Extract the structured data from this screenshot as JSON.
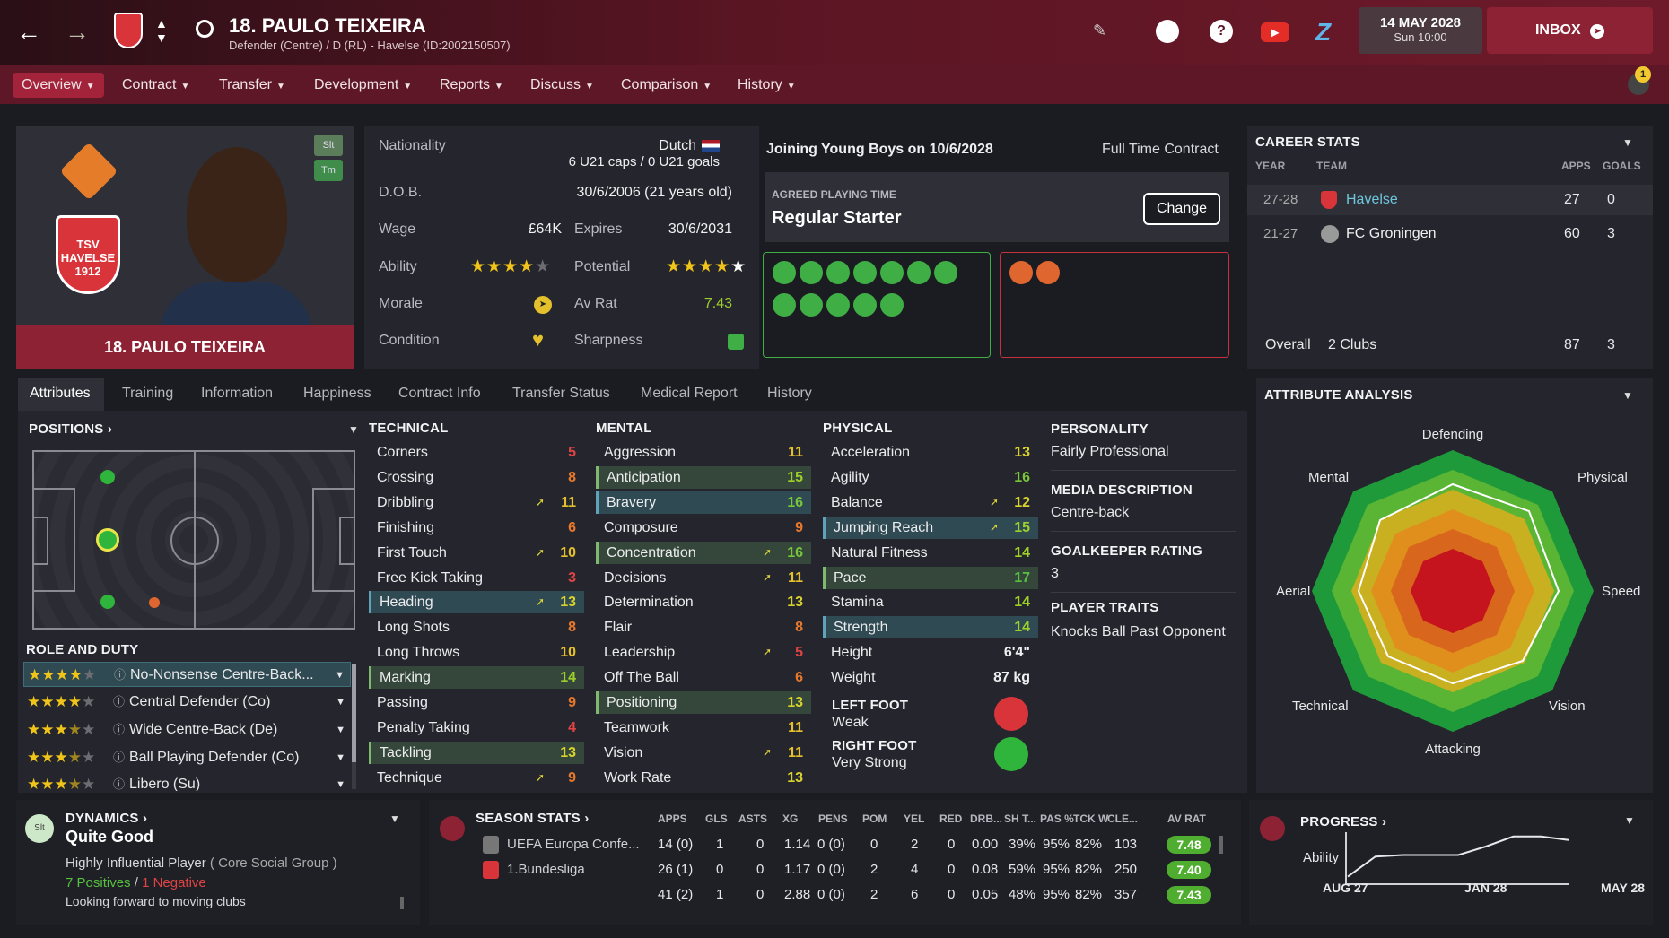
{
  "header": {
    "title": "18. PAULO TEIXEIRA",
    "subtitle": "Defender (Centre) / D (RL) - Havelse (ID:2002150507)",
    "date": "14 MAY 2028",
    "time": "Sun 10:00",
    "inbox": "INBOX",
    "notif_count": "1"
  },
  "nav": [
    "Overview",
    "Contract",
    "Transfer",
    "Development",
    "Reports",
    "Discuss",
    "Comparison",
    "History"
  ],
  "profile": {
    "name": "18. PAULO TEIXEIRA",
    "tag1": "Slt",
    "tag2": "Tm"
  },
  "info": {
    "nationality_label": "Nationality",
    "nationality": "Dutch",
    "caps": "6 U21 caps / 0 U21 goals",
    "dob_label": "D.O.B.",
    "dob": "30/6/2006 (21 years old)",
    "wage_label": "Wage",
    "wage": "£64K",
    "expires_label": "Expires",
    "expires": "30/6/2031",
    "ability_label": "Ability",
    "potential_label": "Potential",
    "morale_label": "Morale",
    "avrat_label": "Av Rat",
    "avrat": "7.43",
    "condition_label": "Condition",
    "sharpness_label": "Sharpness",
    "ability_stars": 4,
    "potential_stars": 5
  },
  "transfer": {
    "joining": "Joining Young Boys on 10/6/2028",
    "contract": "Full Time Contract",
    "agreed_label": "AGREED PLAYING TIME",
    "agreed": "Regular Starter",
    "change": "Change"
  },
  "career": {
    "title": "CAREER STATS",
    "cols": [
      "YEAR",
      "TEAM",
      "APPS",
      "GOALS"
    ],
    "rows": [
      {
        "year": "27-28",
        "team": "Havelse",
        "apps": "27",
        "goals": "0"
      },
      {
        "year": "21-27",
        "team": "FC Groningen",
        "apps": "60",
        "goals": "3"
      }
    ],
    "overall": "Overall",
    "overall_clubs": "2 Clubs",
    "overall_apps": "87",
    "overall_goals": "3"
  },
  "tabs": [
    "Attributes",
    "Training",
    "Information",
    "Happiness",
    "Contract Info",
    "Transfer Status",
    "Medical Report",
    "History"
  ],
  "positions": {
    "title": "POSITIONS",
    "role_title": "ROLE AND DUTY",
    "roles": [
      {
        "name": "No-Nonsense Centre-Back...",
        "stars": 4
      },
      {
        "name": "Central Defender (Co)",
        "stars": 4
      },
      {
        "name": "Wide Centre-Back (De)",
        "stars": 3.5
      },
      {
        "name": "Ball Playing Defender (Co)",
        "stars": 3.5
      },
      {
        "name": "Libero (Su)",
        "stars": 3.5
      }
    ]
  },
  "technical": {
    "title": "TECHNICAL",
    "items": [
      [
        "Corners",
        "5"
      ],
      [
        "Crossing",
        "8"
      ],
      [
        "Dribbling",
        "11"
      ],
      [
        "Finishing",
        "6"
      ],
      [
        "First Touch",
        "10"
      ],
      [
        "Free Kick Taking",
        "3"
      ],
      [
        "Heading",
        "13"
      ],
      [
        "Long Shots",
        "8"
      ],
      [
        "Long Throws",
        "10"
      ],
      [
        "Marking",
        "14"
      ],
      [
        "Passing",
        "9"
      ],
      [
        "Penalty Taking",
        "4"
      ],
      [
        "Tackling",
        "13"
      ],
      [
        "Technique",
        "9"
      ]
    ]
  },
  "mental": {
    "title": "MENTAL",
    "items": [
      [
        "Aggression",
        "11"
      ],
      [
        "Anticipation",
        "15"
      ],
      [
        "Bravery",
        "16"
      ],
      [
        "Composure",
        "9"
      ],
      [
        "Concentration",
        "16"
      ],
      [
        "Decisions",
        "11"
      ],
      [
        "Determination",
        "13"
      ],
      [
        "Flair",
        "8"
      ],
      [
        "Leadership",
        "5"
      ],
      [
        "Off The Ball",
        "6"
      ],
      [
        "Positioning",
        "13"
      ],
      [
        "Teamwork",
        "11"
      ],
      [
        "Vision",
        "11"
      ],
      [
        "Work Rate",
        "13"
      ]
    ]
  },
  "physical": {
    "title": "PHYSICAL",
    "items": [
      [
        "Acceleration",
        "13"
      ],
      [
        "Agility",
        "16"
      ],
      [
        "Balance",
        "12"
      ],
      [
        "Jumping Reach",
        "15"
      ],
      [
        "Natural Fitness",
        "14"
      ],
      [
        "Pace",
        "17"
      ],
      [
        "Stamina",
        "14"
      ],
      [
        "Strength",
        "14"
      ],
      [
        "Height",
        "6'4\""
      ],
      [
        "Weight",
        "87 kg"
      ]
    ],
    "left_foot_label": "LEFT FOOT",
    "left_foot": "Weak",
    "right_foot_label": "RIGHT FOOT",
    "right_foot": "Very Strong"
  },
  "personality": {
    "title": "PERSONALITY",
    "value": "Fairly Professional",
    "media_title": "MEDIA DESCRIPTION",
    "media": "Centre-back",
    "gk_title": "GOALKEEPER RATING",
    "gk": "3",
    "traits_title": "PLAYER TRAITS",
    "traits": "Knocks Ball Past Opponent"
  },
  "analysis": {
    "title": "ATTRIBUTE ANALYSIS",
    "labels": [
      "Defending",
      "Physical",
      "Speed",
      "Vision",
      "Attacking",
      "Technical",
      "Aerial",
      "Mental"
    ]
  },
  "dynamics": {
    "title": "DYNAMICS",
    "value": "Quite Good",
    "influence": "Highly Influential Player",
    "group": "( Core Social Group )",
    "positives": "7 Positives",
    "sep": "/",
    "negatives": "1 Negative",
    "note": "Looking forward to moving clubs",
    "badge": "Slt"
  },
  "season": {
    "title": "SEASON STATS",
    "cols": [
      "APPS",
      "GLS",
      "ASTS",
      "XG",
      "PENS",
      "POM",
      "YEL",
      "RED",
      "DRB...",
      "SH T...",
      "PAS %",
      "TCK W",
      "CLE...",
      "AV RAT"
    ],
    "rows": [
      {
        "comp": "UEFA Europa Confe...",
        "vals": [
          "14 (0)",
          "1",
          "0",
          "1.14",
          "0 (0)",
          "0",
          "2",
          "0",
          "0.00",
          "39%",
          "95%",
          "82%",
          "103"
        ],
        "rat": "7.48"
      },
      {
        "comp": "1.Bundesliga",
        "vals": [
          "26 (1)",
          "0",
          "0",
          "1.17",
          "0 (0)",
          "2",
          "4",
          "0",
          "0.08",
          "59%",
          "95%",
          "82%",
          "250"
        ],
        "rat": "7.40"
      },
      {
        "comp": "",
        "vals": [
          "41 (2)",
          "1",
          "0",
          "2.88",
          "0 (0)",
          "2",
          "6",
          "0",
          "0.05",
          "48%",
          "95%",
          "82%",
          "357"
        ],
        "rat": "7.43"
      }
    ]
  },
  "progress": {
    "title": "PROGRESS",
    "ability": "Ability",
    "labels": [
      "AUG 27",
      "JAN 28",
      "MAY 28"
    ],
    "values": [
      0.15,
      0.55,
      0.58,
      0.58,
      0.58,
      0.75,
      0.95,
      0.95,
      0.88
    ]
  },
  "colors": {
    "accent": "#6e1a2a",
    "green": "#3fae45",
    "gold": "#f0c419"
  }
}
